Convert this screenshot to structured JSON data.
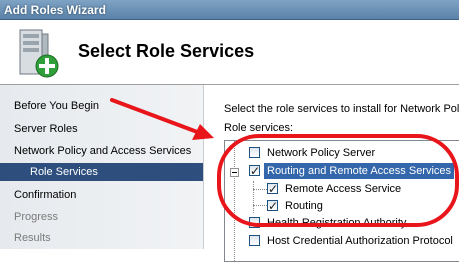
{
  "window": {
    "title": "Add Roles Wizard"
  },
  "header": {
    "heading": "Select Role Services"
  },
  "nav": {
    "items": [
      {
        "label": "Before You Begin",
        "state": "normal"
      },
      {
        "label": "Server Roles",
        "state": "normal"
      },
      {
        "label": "Network Policy and Access Services",
        "state": "normal"
      },
      {
        "label": "Role Services",
        "state": "active"
      },
      {
        "label": "Confirmation",
        "state": "normal"
      },
      {
        "label": "Progress",
        "state": "disabled"
      },
      {
        "label": "Results",
        "state": "disabled"
      }
    ]
  },
  "main": {
    "instruction": "Select the role services to install for Network Polic",
    "role_services_label": "Role services:",
    "services": [
      {
        "label": "Network Policy Server",
        "checked": false
      },
      {
        "label": "Routing and Remote Access Services",
        "checked": true,
        "selected": true,
        "expanded": true
      },
      {
        "label": "Remote Access Service",
        "checked": true
      },
      {
        "label": "Routing",
        "checked": true
      },
      {
        "label": "Health Registration Authority",
        "checked": false
      },
      {
        "label": "Host Credential Authorization Protocol",
        "checked": false
      }
    ]
  },
  "annotation": {
    "color": "#e8151b"
  },
  "icons": {
    "wizard": "server-add-icon"
  }
}
